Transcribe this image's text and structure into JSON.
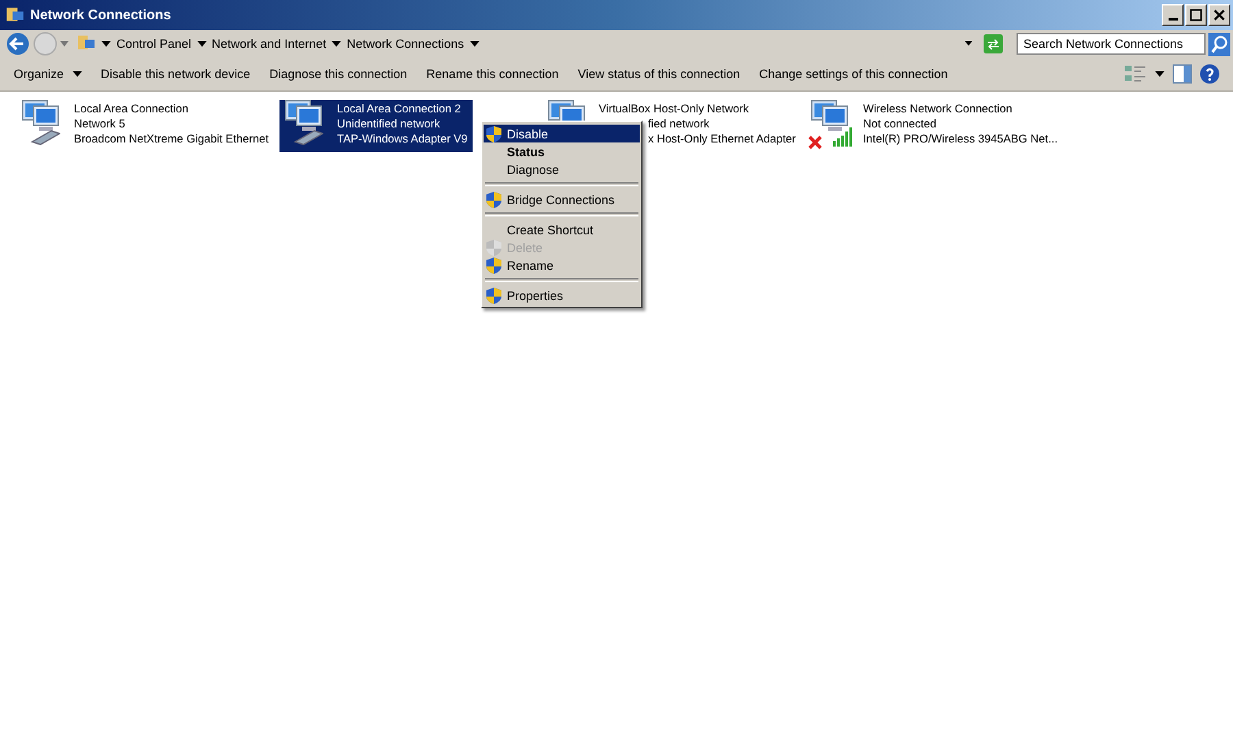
{
  "window": {
    "title": "Network Connections"
  },
  "address": {
    "crumbs": [
      "Control Panel",
      "Network and Internet",
      "Network Connections"
    ],
    "search_placeholder": "Search Network Connections"
  },
  "toolbar": [
    "Organize",
    "Disable this network device",
    "Diagnose this connection",
    "Rename this connection",
    "View status of this connection",
    "Change settings of this connection"
  ],
  "connections": [
    {
      "name": "Local Area Connection",
      "status": "Network  5",
      "adapter": "Broadcom NetXtreme Gigabit Ethernet",
      "kind": "wired",
      "selected": false,
      "covered": false
    },
    {
      "name": "Local Area Connection 2",
      "status": "Unidentified network",
      "adapter": "TAP-Windows Adapter V9",
      "kind": "wired",
      "selected": true,
      "covered": false
    },
    {
      "name": "VirtualBox Host-Only Network",
      "status": "fied network",
      "adapter": "x Host-Only Ethernet Adapter",
      "kind": "plain",
      "selected": false,
      "covered": true
    },
    {
      "name": "Wireless Network Connection",
      "status": "Not connected",
      "adapter": "Intel(R) PRO/Wireless 3945ABG Net...",
      "kind": "wireless",
      "selected": false,
      "covered": false
    }
  ],
  "context_menu": [
    {
      "kind": "item",
      "label": "Disable",
      "shield": true,
      "bold": false,
      "disabled": false,
      "selected": true
    },
    {
      "kind": "item",
      "label": "Status",
      "shield": false,
      "bold": true,
      "disabled": false,
      "selected": false
    },
    {
      "kind": "item",
      "label": "Diagnose",
      "shield": false,
      "bold": false,
      "disabled": false,
      "selected": false
    },
    {
      "kind": "separator"
    },
    {
      "kind": "item",
      "label": "Bridge Connections",
      "shield": true,
      "bold": false,
      "disabled": false,
      "selected": false
    },
    {
      "kind": "separator"
    },
    {
      "kind": "item",
      "label": "Create Shortcut",
      "shield": false,
      "bold": false,
      "disabled": false,
      "selected": false
    },
    {
      "kind": "item",
      "label": "Delete",
      "shield": true,
      "bold": false,
      "disabled": true,
      "selected": false
    },
    {
      "kind": "item",
      "label": "Rename",
      "shield": true,
      "bold": false,
      "disabled": false,
      "selected": false
    },
    {
      "kind": "separator"
    },
    {
      "kind": "item",
      "label": "Properties",
      "shield": true,
      "bold": false,
      "disabled": false,
      "selected": false
    }
  ]
}
